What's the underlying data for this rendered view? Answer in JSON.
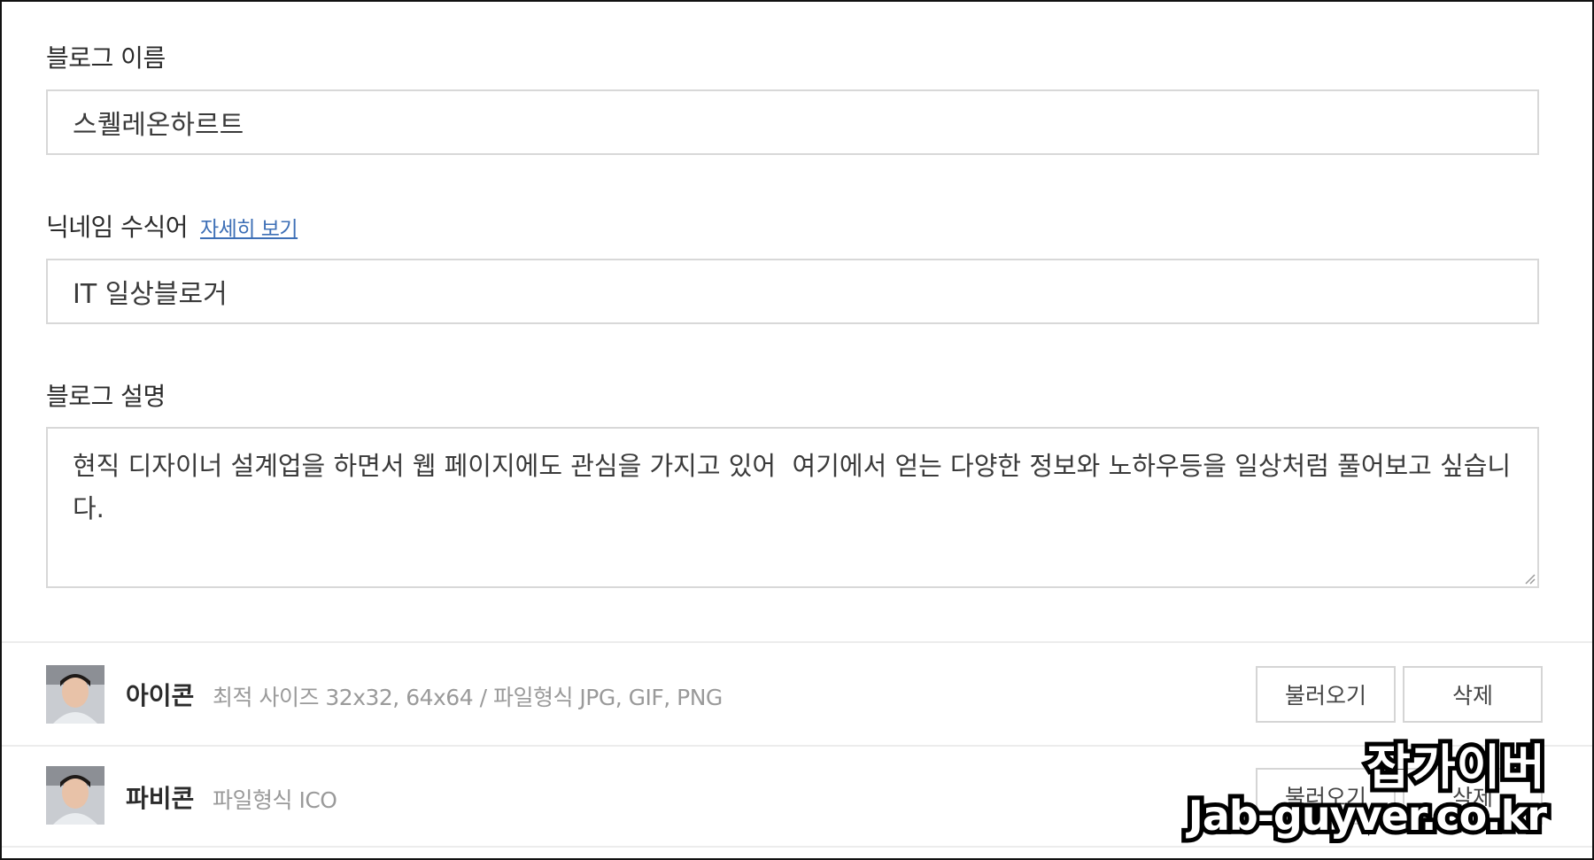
{
  "blog_name": {
    "label": "블로그 이름",
    "value": "스퀠레온하르트"
  },
  "nickname_modifier": {
    "label": "닉네임 수식어",
    "detail_link": "자세히 보기",
    "value": "IT 일상블로거"
  },
  "blog_description": {
    "label": "블로그 설명",
    "value": "현직 디자이너 설계업을 하면서 웹 페이지에도 관심을 가지고 있어  여기에서 얻는 다양한 정보와 노하우등을 일상처럼 풀어보고 싶습니다."
  },
  "icon_row": {
    "title": "아이콘",
    "hint": "최적 사이즈 32x32, 64x64 / 파일형식 JPG, GIF, PNG",
    "load_button": "불러오기",
    "delete_button": "삭제"
  },
  "favicon_row": {
    "title": "파비콘",
    "hint": "파일형식 ICO",
    "load_button": "불러오기",
    "delete_button": "삭제"
  },
  "watermark": {
    "line1": "잡가이버",
    "line2": "Jab-guyver.co.kr"
  },
  "colors": {
    "link": "#3d6fb6",
    "input_border": "#d8d8d8",
    "hint_text": "#9a9a9a"
  }
}
